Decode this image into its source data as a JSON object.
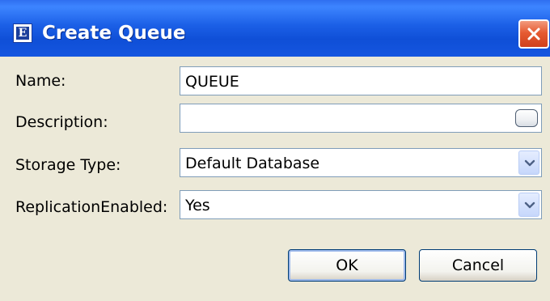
{
  "dialog": {
    "title": "Create Queue",
    "app_icon_glyph": "E"
  },
  "fields": {
    "name": {
      "label": "Name:",
      "value": "QUEUE"
    },
    "description": {
      "label": "Description:",
      "value": ""
    },
    "storage_type": {
      "label": "Storage Type:",
      "value": "Default Database"
    },
    "replication_enabled": {
      "label": "ReplicationEnabled:",
      "value": "Yes"
    }
  },
  "buttons": {
    "ok": "OK",
    "cancel": "Cancel"
  },
  "colors": {
    "titlebar": "#1b5fe6",
    "close": "#e65b32",
    "dialog_bg": "#ece9d8"
  },
  "icons": {
    "app": "app-icon",
    "close": "close-icon",
    "more": "ellipsis-button",
    "dropdown": "chevron-down-icon"
  }
}
